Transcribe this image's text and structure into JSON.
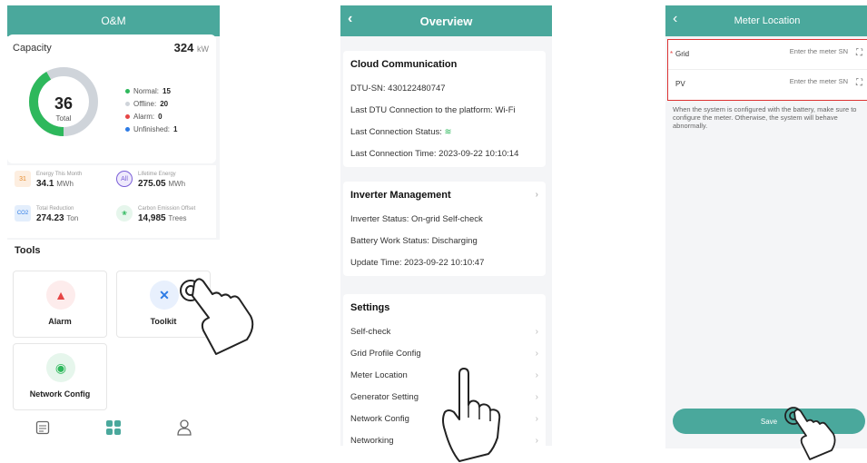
{
  "om": {
    "title": "O&M",
    "capacity_label": "Capacity",
    "capacity_value": "324",
    "capacity_unit": "kW",
    "total_count": "36",
    "total_label": "Total",
    "legend": [
      {
        "label": "Normal:",
        "value": "15",
        "color": "#2eb85c"
      },
      {
        "label": "Offline:",
        "value": "20",
        "color": "#cfd4da"
      },
      {
        "label": "Alarm:",
        "value": "0",
        "color": "#e64545"
      },
      {
        "label": "Unfinished:",
        "value": "1",
        "color": "#2d7be5"
      }
    ],
    "stats": [
      {
        "label": "Energy This Month",
        "value": "34.1",
        "unit": "MWh",
        "icon": "31"
      },
      {
        "label": "Lifetime Energy",
        "value": "275.05",
        "unit": "MWh",
        "icon": "All"
      },
      {
        "label": "Total Reduction",
        "value": "274.23",
        "unit": "Ton",
        "icon": "CO2"
      },
      {
        "label": "Carbon Emission Offset",
        "value": "14,985",
        "unit": "Trees",
        "icon": "tree"
      }
    ],
    "tools_title": "Tools",
    "tools": [
      {
        "label": "Alarm",
        "icon": "alarm-icon"
      },
      {
        "label": "Toolkit",
        "icon": "toolkit-icon"
      },
      {
        "label": "Network Config",
        "icon": "router-icon"
      }
    ],
    "tabs": [
      "list-icon",
      "grid-icon",
      "user-icon"
    ]
  },
  "overview": {
    "title": "Overview",
    "cloud": {
      "header": "Cloud Communication",
      "dtu_sn": "DTU-SN:  430122480747",
      "last_conn_platform": "Last DTU Connection to the platform:  Wi-Fi",
      "last_conn_status": "Last Connection Status:",
      "last_conn_time": "Last Connection Time:  2023-09-22 10:10:14"
    },
    "inverter": {
      "header": "Inverter Management",
      "status": "Inverter Status:  On-grid Self-check",
      "battery": "Battery Work Status:  Discharging",
      "update": "Update Time:  2023-09-22 10:10:47"
    },
    "settings": {
      "header": "Settings",
      "items": [
        "Self-check",
        "Grid Profile Config",
        "Meter Location",
        "Generator Setting",
        "Network Config",
        "Networking"
      ]
    }
  },
  "meter": {
    "title": "Meter Location",
    "grid_required": "*",
    "grid_label": "Grid",
    "pv_label": "PV",
    "placeholder": "Enter the meter SN",
    "note": "When the system is configured with the battery, make sure to configure the meter. Otherwise, the system will behave abnormally.",
    "save": "Save"
  }
}
